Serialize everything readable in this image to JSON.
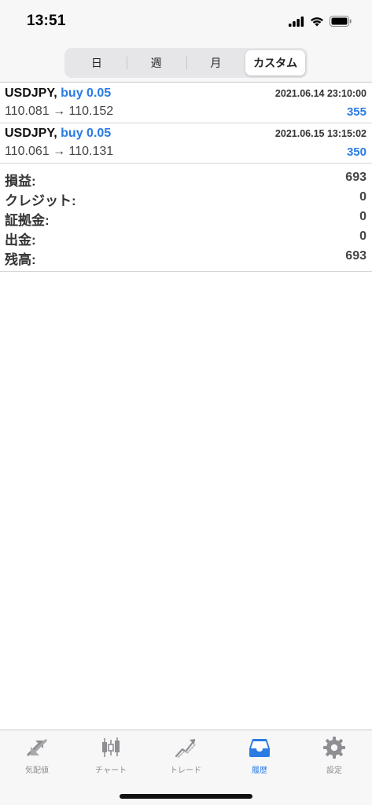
{
  "status_bar": {
    "time": "13:51",
    "icons": [
      "cellular-signal-icon",
      "wifi-icon",
      "battery-icon"
    ]
  },
  "period_tabs": [
    {
      "label": "日",
      "active": false
    },
    {
      "label": "週",
      "active": false
    },
    {
      "label": "月",
      "active": false
    },
    {
      "label": "カスタム",
      "active": true
    }
  ],
  "trades": [
    {
      "symbol": "USDJPY,",
      "side": "buy 0.05",
      "datetime": "2021.06.14 23:10:00",
      "prices": "110.081 → 110.152",
      "profit": "355"
    },
    {
      "symbol": "USDJPY,",
      "side": "buy 0.05",
      "datetime": "2021.06.15 13:15:02",
      "prices": "110.061 → 110.131",
      "profit": "350"
    }
  ],
  "summary": [
    {
      "label": "損益:",
      "value": "693"
    },
    {
      "label": "クレジット:",
      "value": "0"
    },
    {
      "label": "証拠金:",
      "value": "0"
    },
    {
      "label": "出金:",
      "value": "0"
    },
    {
      "label": "残高:",
      "value": "693"
    }
  ],
  "tab_bar": [
    {
      "label": "気配値",
      "icon": "quotes-arrows-icon",
      "active": false
    },
    {
      "label": "チャート",
      "icon": "candlestick-chart-icon",
      "active": false
    },
    {
      "label": "トレード",
      "icon": "trade-line-icon",
      "active": false
    },
    {
      "label": "履歴",
      "icon": "history-inbox-icon",
      "active": true
    },
    {
      "label": "設定",
      "icon": "gear-icon",
      "active": false
    }
  ],
  "colors": {
    "accent": "#2a7be4",
    "inactive": "#8e8e93",
    "text": "#333333"
  }
}
